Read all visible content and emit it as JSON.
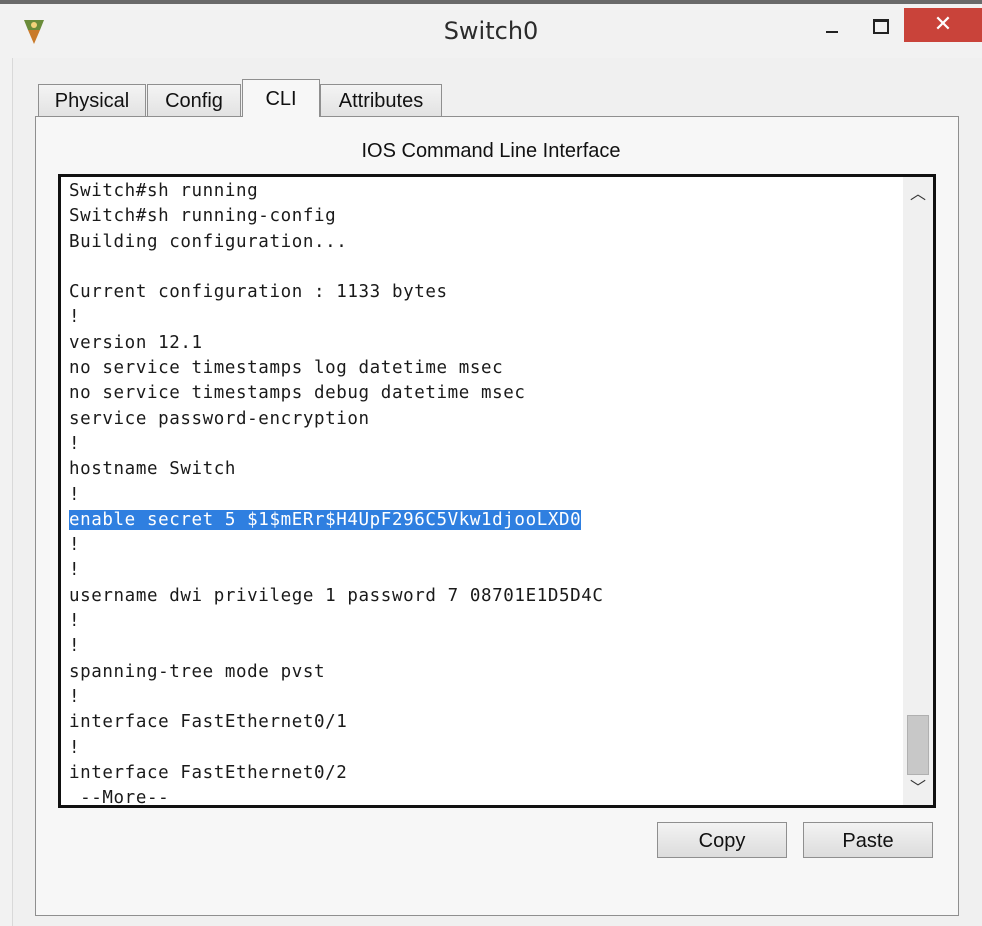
{
  "window": {
    "title": "Switch0",
    "close_glyph": "✕"
  },
  "tabs": [
    {
      "label": "Physical",
      "active": false
    },
    {
      "label": "Config",
      "active": false
    },
    {
      "label": "CLI",
      "active": true
    },
    {
      "label": "Attributes",
      "active": false
    }
  ],
  "cli": {
    "heading": "IOS Command Line Interface",
    "lines": [
      "Switch#sh running",
      "Switch#sh running-config",
      "Building configuration...",
      "",
      "Current configuration : 1133 bytes",
      "!",
      "version 12.1",
      "no service timestamps log datetime msec",
      "no service timestamps debug datetime msec",
      "service password-encryption",
      "!",
      "hostname Switch",
      "!",
      "enable secret 5 $1$mERr$H4UpF296C5Vkw1djooLXD0",
      "!",
      "!",
      "username dwi privilege 1 password 7 08701E1D5D4C",
      "!",
      "!",
      "spanning-tree mode pvst",
      "!",
      "interface FastEthernet0/1",
      "!",
      "interface FastEthernet0/2",
      " --More--"
    ],
    "selected_line_index": 13,
    "scroll_up_glyph": "︿",
    "scroll_down_glyph": "﹀"
  },
  "buttons": {
    "copy": "Copy",
    "paste": "Paste"
  },
  "icons": {
    "app": "packet-tracer-switch-icon",
    "minimize": "minimize-icon",
    "maximize": "maximize-icon",
    "close": "close-icon"
  },
  "colors": {
    "selection": "#2f7fe0",
    "close_button": "#c9433a"
  }
}
